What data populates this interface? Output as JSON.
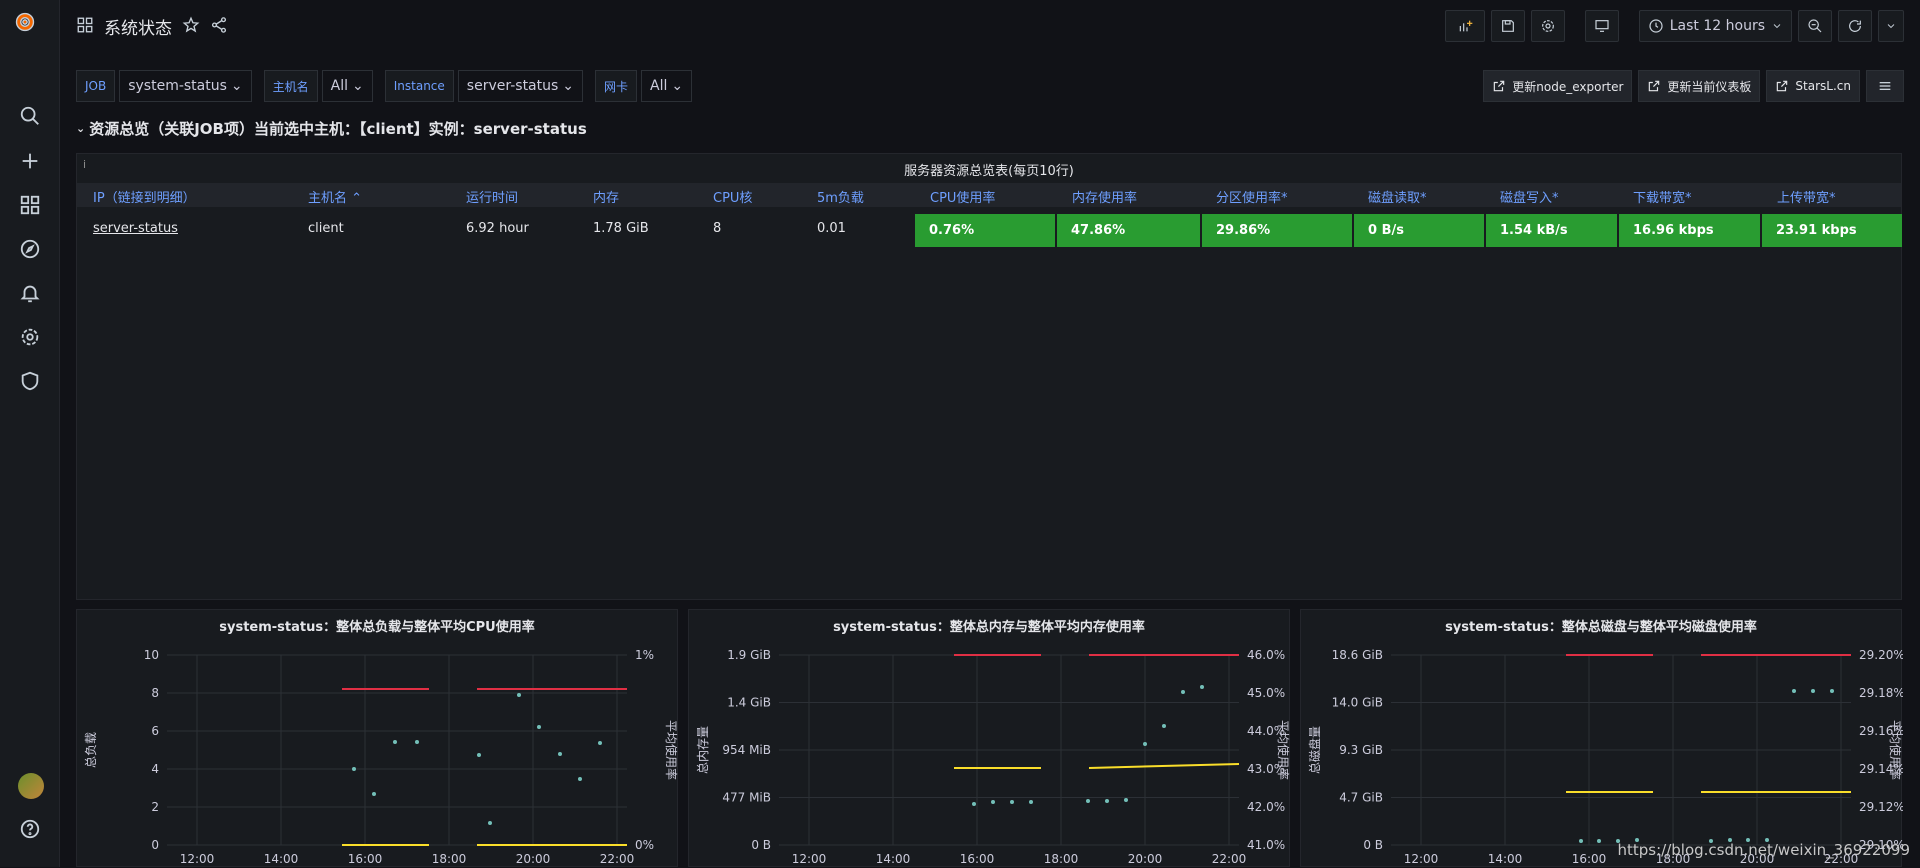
{
  "header": {
    "title": "系统状态",
    "time_range": "Last 12 hours"
  },
  "variables": [
    {
      "label": "JOB",
      "value": "system-status"
    },
    {
      "label": "主机名",
      "value": "All"
    },
    {
      "label": "Instance",
      "value": "server-status"
    },
    {
      "label": "网卡",
      "value": "All"
    }
  ],
  "links": [
    "更新node_exporter",
    "更新当前仪表板",
    "StarsL.cn"
  ],
  "row": {
    "title": "资源总览（关联JOB项）当前选中主机：【client】实例：server-status"
  },
  "table": {
    "title": "服务器资源总览表(每页10行)",
    "info": "i",
    "columns": [
      "IP（链接到明细）",
      "主机名 ⌃",
      "运行时间",
      "内存",
      "CPU核",
      "5m负载",
      "CPU使用率",
      "内存使用率",
      "分区使用率*",
      "磁盘读取*",
      "磁盘写入*",
      "下载带宽*",
      "上传带宽*"
    ],
    "rows": [
      [
        "server-status",
        "client",
        "6.92 hour",
        "1.78 GiB",
        "8",
        "0.01",
        "0.76%",
        "47.86%",
        "29.86%",
        "0 B/s",
        "1.54 kB/s",
        "16.96 kbps",
        "23.91 kbps"
      ]
    ]
  },
  "charts": [
    {
      "title": "system-status：整体总负载与整体平均CPU使用率",
      "ylabel_left": "总负载",
      "ylabel_right": "平均使用率",
      "y_left": [
        "10",
        "8",
        "6",
        "4",
        "2",
        "0"
      ],
      "y_right": [
        "1%",
        "0%"
      ],
      "x": [
        "12:00",
        "14:00",
        "16:00",
        "18:00",
        "20:00",
        "22:00"
      ]
    },
    {
      "title": "system-status：整体总内存与整体平均内存使用率",
      "ylabel_left": "总内存量",
      "ylabel_right": "平均使用率",
      "y_left": [
        "1.9 GiB",
        "1.4 GiB",
        "954 MiB",
        "477 MiB",
        "0 B"
      ],
      "y_right": [
        "46.0%",
        "45.0%",
        "44.0%",
        "43.0%",
        "42.0%",
        "41.0%"
      ],
      "x": [
        "12:00",
        "14:00",
        "16:00",
        "18:00",
        "20:00",
        "22:00"
      ]
    },
    {
      "title": "system-status：整体总磁盘与整体平均磁盘使用率",
      "ylabel_left": "总磁盘量",
      "ylabel_right": "平均使用率",
      "y_left": [
        "18.6 GiB",
        "14.0 GiB",
        "9.3 GiB",
        "4.7 GiB",
        "0 B"
      ],
      "y_right": [
        "29.20%",
        "29.18%",
        "29.16%",
        "29.14%",
        "29.12%",
        "29.10%"
      ],
      "x": [
        "12:00",
        "14:00",
        "16:00",
        "18:00",
        "20:00",
        "22:00"
      ]
    }
  ],
  "watermark": "https://blog.csdn.net/weixin_36922099",
  "colors": {
    "green": "#299c31",
    "blue": "#6e9fff",
    "red": "#e02f44",
    "yellow": "#fade2a",
    "cyan": "#73bfb8"
  }
}
